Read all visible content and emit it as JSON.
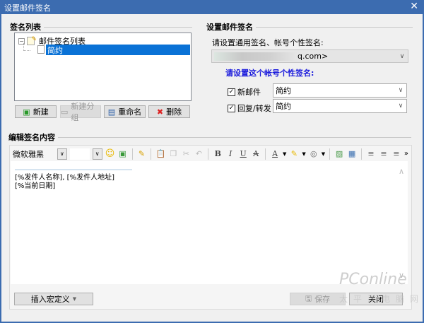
{
  "window": {
    "title": "设置邮件签名",
    "close": "✕"
  },
  "left": {
    "group_label": "签名列表",
    "tree_root": "邮件签名列表",
    "tree_item": "简约",
    "buttons": {
      "new": "新建",
      "new_group": "新建分组",
      "rename": "重命名",
      "delete": "删除"
    }
  },
  "right": {
    "group_label": "设置邮件签名",
    "prompt": "请设置通用签名、帐号个性签名:",
    "account": "q.com>",
    "account_prompt": "请设置这个帐号个性签名:",
    "accent": "#1a1adc",
    "rows": [
      {
        "label": "新邮件",
        "checked": true,
        "value": "简约"
      },
      {
        "label": "回复/转发",
        "checked": true,
        "value": "简约"
      }
    ]
  },
  "editor": {
    "group_label": "编辑签名内容",
    "font": "微软雅黑",
    "size": "",
    "toolbar": {
      "bold": "B",
      "italic": "I",
      "underline": "U",
      "strike": "A",
      "color": "A",
      "more": "»"
    },
    "lines": [
      "[%发件人名称], [%发件人地址]",
      "[%当前日期]"
    ]
  },
  "bottom": {
    "insert_macro": "插入宏定义",
    "save": "保存",
    "close": "关闭"
  },
  "watermark": {
    "brand": "PConline",
    "sub": "太平洋电脑网"
  }
}
